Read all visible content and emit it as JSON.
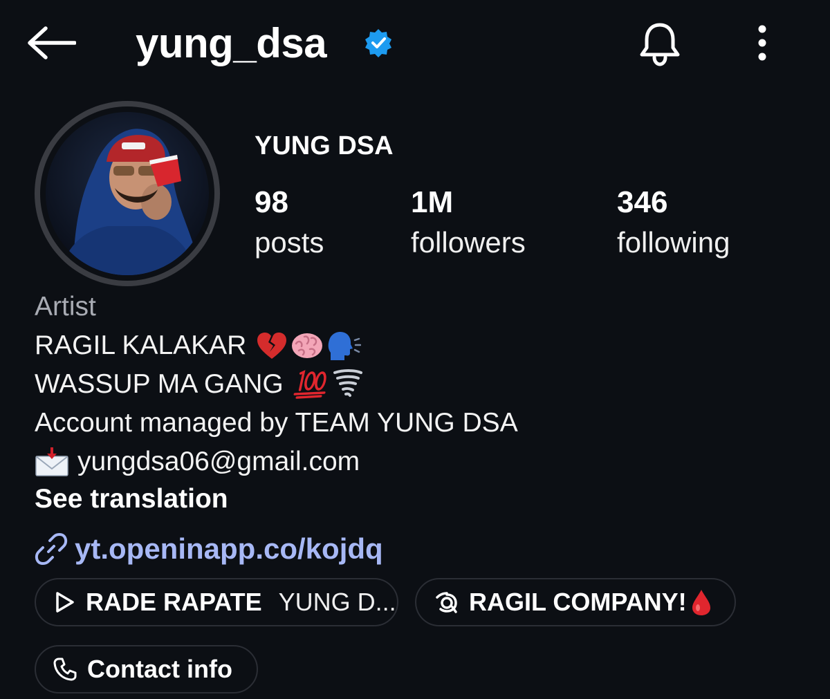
{
  "header": {
    "username": "yung_dsa",
    "icons": {
      "back": "arrow-left-icon",
      "verified": "verified-badge-icon",
      "notifications": "bell-icon",
      "more": "more-vertical-icon"
    }
  },
  "profile": {
    "display_name": "YUNG DSA",
    "stats": [
      {
        "value": "98",
        "label": "posts"
      },
      {
        "value": "1M",
        "label": "followers"
      },
      {
        "value": "346",
        "label": "following"
      }
    ]
  },
  "bio": {
    "category": "Artist",
    "line1": "RAGIL KALAKAR",
    "line1_emojis": [
      "broken-heart",
      "brain",
      "speaking-head"
    ],
    "line2": "WASSUP MA GANG",
    "line2_emojis": [
      "hundred-points",
      "tornado"
    ],
    "line3": "Account managed by TEAM YUNG DSA",
    "email_icon": "envelope-arrow-icon",
    "email": "yungdsa06@gmail.com",
    "see_translation": "See translation",
    "link_icon": "link-icon",
    "link": "yt.openinapp.co/kojdq"
  },
  "chips": [
    {
      "icon": "play-icon",
      "label": "RADE RAPATE",
      "sublabel": "YUNG D..."
    },
    {
      "icon": "threads-icon",
      "label": "RAGIL COMPANY!",
      "emoji": "drop-of-blood"
    },
    {
      "icon": "phone-icon",
      "label": "Contact info"
    }
  ],
  "colors": {
    "background": "#0c0f14",
    "link": "#a7b8f5",
    "verified": "#1d9bf0",
    "muted": "#a8abb3"
  }
}
